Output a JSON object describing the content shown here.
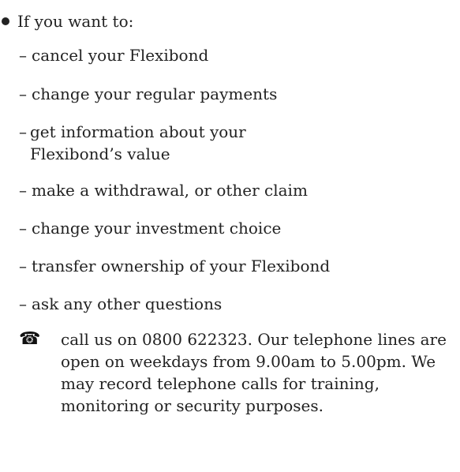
{
  "intro": {
    "bullet_text": "If you want to:"
  },
  "options": [
    {
      "text": "cancel your Flexibond"
    },
    {
      "text": "change your regular payments"
    },
    {
      "text": "get information about your Flexibond’s value"
    },
    {
      "text": "make a withdrawal, or other claim"
    },
    {
      "text": "change your investment choice"
    },
    {
      "text": "transfer ownership of your Flexibond"
    },
    {
      "text": "ask any other questions"
    }
  ],
  "contact": {
    "icon": "telephone-icon",
    "text": "call us on 0800 622323. Our telephone lines are open on weekdays from 9.00am to 5.00pm. We may record telephone calls for training, monitoring or security purposes."
  },
  "colors": {
    "text": "#222222",
    "background": "#ffffff"
  }
}
